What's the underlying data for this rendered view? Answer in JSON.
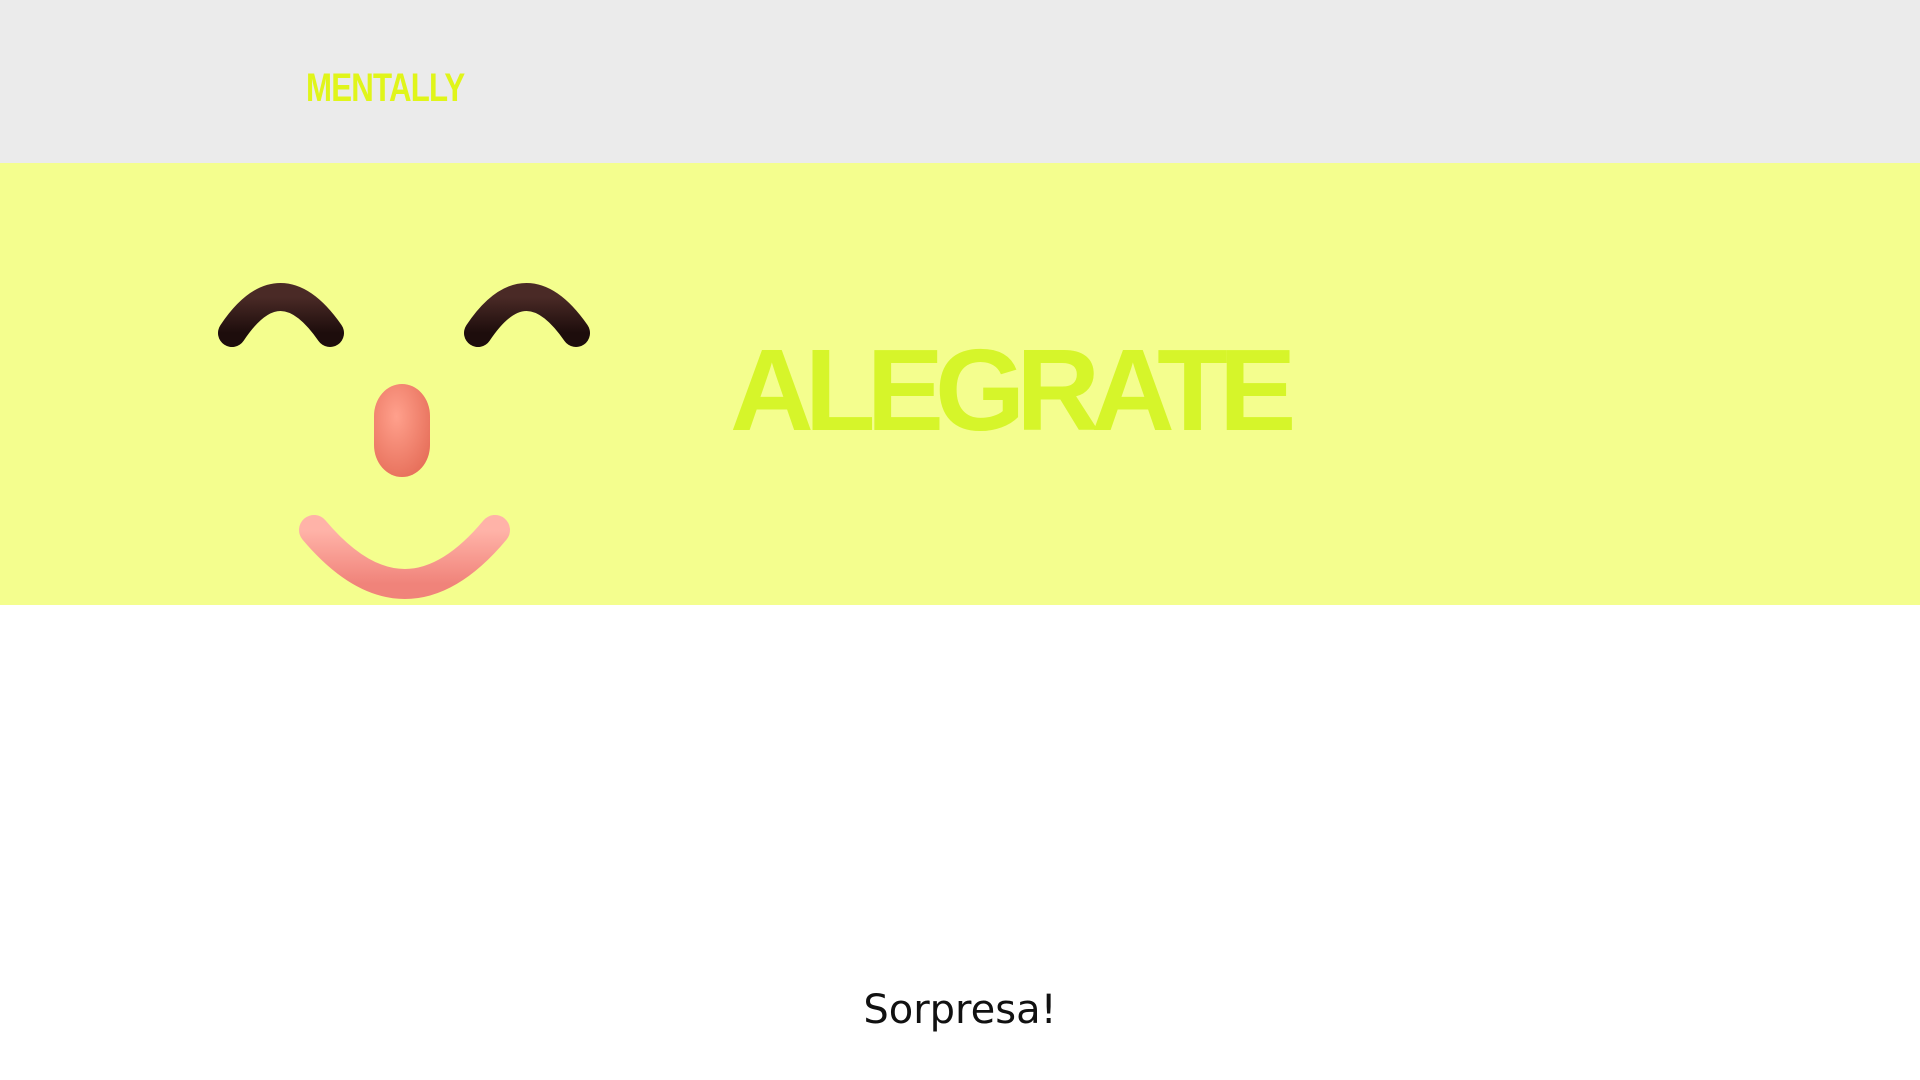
{
  "header": {
    "brand": "MENTALLY"
  },
  "hero": {
    "title": "ALEGRATE",
    "illustration": "smiley-face-icon"
  },
  "main": {
    "caption": "Sorpresa!"
  },
  "colors": {
    "header_bg": "#ebebeb",
    "hero_bg": "#f4fe8e",
    "brand": "#e0f51a",
    "title": "#d6f52a",
    "caption": "#111111",
    "eye": "#2a1513",
    "nose": "#f2826c",
    "mouth": "#f69a8e"
  }
}
